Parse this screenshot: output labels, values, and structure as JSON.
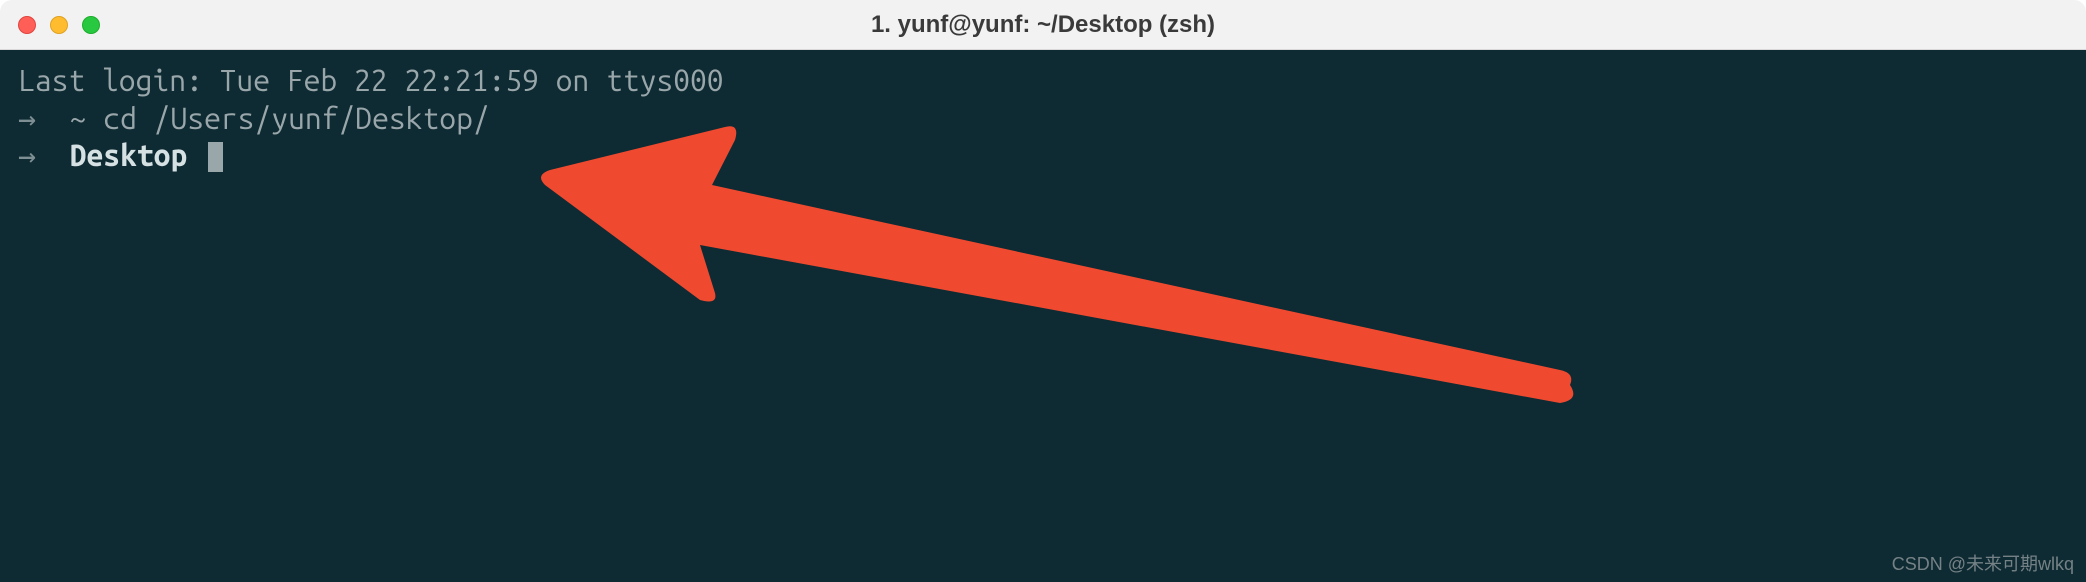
{
  "titlebar": {
    "title": "1. yunf@yunf: ~/Desktop (zsh)"
  },
  "terminal": {
    "line1": "Last login: Tue Feb 22 22:21:59 on ttys000",
    "line2_prompt": "→  ",
    "line2_dir": "~",
    "line2_cmd": " cd /Users/yunf/Desktop/",
    "line3_prompt": "→  ",
    "line3_dir": "Desktop"
  },
  "watermark": "CSDN @未来可期wlkq"
}
